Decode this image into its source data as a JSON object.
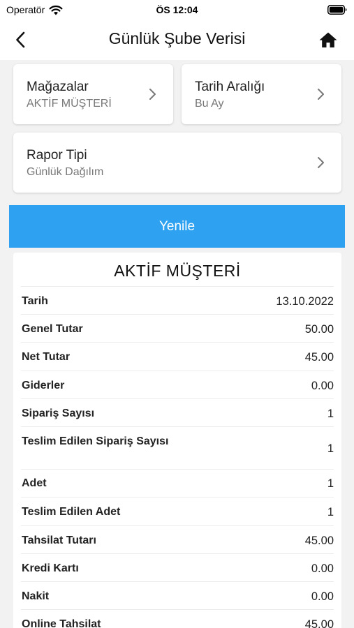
{
  "status_bar": {
    "carrier": "Operatör",
    "time": "ÖS 12:04"
  },
  "nav": {
    "title": "Günlük Şube Verisi"
  },
  "filters": {
    "stores": {
      "title": "Mağazalar",
      "value": "AKTİF MÜŞTERİ"
    },
    "date_range": {
      "title": "Tarih Aralığı",
      "value": "Bu Ay"
    },
    "report_type": {
      "title": "Rapor Tipi",
      "value": "Günlük Dağılım"
    }
  },
  "refresh_button": {
    "label": "Yenile",
    "color": "#2ea1f0"
  },
  "report": {
    "title": "AKTİF MÜŞTERİ",
    "rows": [
      {
        "label": "Tarih",
        "value": "13.10.2022"
      },
      {
        "label": "Genel Tutar",
        "value": "50.00"
      },
      {
        "label": "Net Tutar",
        "value": "45.00"
      },
      {
        "label": "Giderler",
        "value": "0.00"
      },
      {
        "label": "Sipariş Sayısı",
        "value": "1"
      },
      {
        "label": "Teslim Edilen Sipariş Sayısı",
        "value": "1"
      },
      {
        "label": "Adet",
        "value": "1"
      },
      {
        "label": "Teslim Edilen Adet",
        "value": "1"
      },
      {
        "label": "Tahsilat Tutarı",
        "value": "45.00"
      },
      {
        "label": "Kredi Kartı",
        "value": "0.00"
      },
      {
        "label": "Nakit",
        "value": "0.00"
      },
      {
        "label": "Online Tahsilat",
        "value": "45.00"
      }
    ]
  }
}
